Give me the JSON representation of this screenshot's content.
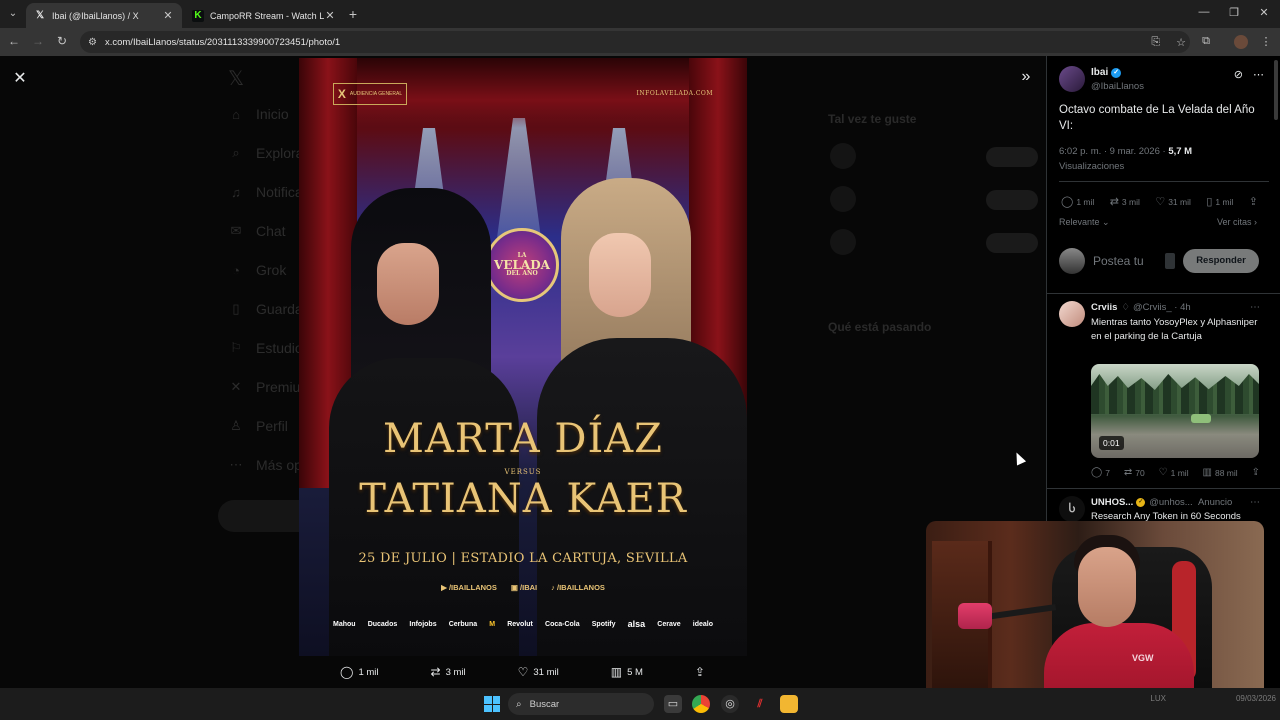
{
  "browser": {
    "tabs": [
      {
        "title": "Ibai (@IbaiLlanos) / X",
        "favicon": "x-logo-icon",
        "active": true
      },
      {
        "title": "CampoRR Stream - Watch Live",
        "favicon": "k-logo-icon",
        "active": false
      }
    ],
    "new_tab": "+",
    "url": "x.com/IbaiLlanos/status/2031113339900723451/photo/1"
  },
  "background_page": {
    "nav": [
      "Inicio",
      "Explorar",
      "Notificaciones",
      "Chat",
      "Grok",
      "Guardados",
      "Estudio",
      "Premium",
      "Perfil",
      "Más opciones"
    ],
    "sidebar_title_1": "Tal vez te guste",
    "sidebar_title_2": "Qué está pasando"
  },
  "poster": {
    "badge": "AUDIENCIA GENERAL",
    "site": "INFOLAVELADA.COM",
    "emblem_top": "LA",
    "emblem_main": "VELADA",
    "emblem_bottom": "DEL AÑO",
    "fighter1": "MARTA DÍAZ",
    "versus": "VERSUS",
    "fighter2": "TATIANA KAER",
    "date_venue": "25 DE JULIO | ESTADIO LA CARTUJA, SEVILLA",
    "socials": [
      "/IBAILLANOS",
      "/IBAI",
      "/IBAILLANOS"
    ],
    "sponsors": [
      "Mahou",
      "Ducados",
      "Infojobs",
      "Cerbuna",
      "M",
      "Revolut",
      "Coca-Cola",
      "Spotify",
      "alsa",
      "Cerave",
      "idealo"
    ]
  },
  "image_actions": {
    "replies": "1 mil",
    "reposts": "3 mil",
    "likes": "31 mil",
    "views": "5 M"
  },
  "post": {
    "author": "Ibai",
    "handle": "@IbaiLlanos",
    "text": "Octavo combate de La Velada del Año VI:",
    "time": "6:02 p. m. · 9 mar. 2026 · ",
    "views_count": "5,7 M",
    "views_label": "Visualizaciones",
    "actions": {
      "replies": "1 mil",
      "reposts": "3 mil",
      "likes": "31 mil",
      "bookmarks": "1 mil"
    },
    "sort": "Relevante",
    "quotes_link": "Ver citas",
    "reply_placeholder": "Postea tu",
    "reply_button": "Responder"
  },
  "reply": {
    "author": "Crviis",
    "handle": "@Crviis_",
    "age": "· 4h",
    "text": "Mientras tanto YosoyPlex y Alphasniper en el parking de la Cartuja",
    "video_duration": "0:01",
    "actions": {
      "replies": "7",
      "reposts": "70",
      "likes": "1 mil",
      "views": "88 mil"
    }
  },
  "ad": {
    "author": "UNHOS...",
    "handle": "@unhos...",
    "label": "Anuncio",
    "text": "Research Any Token in 60 Seconds"
  },
  "webcam": {
    "shirt_logo": "VGW"
  },
  "taskbar": {
    "search_placeholder": "Buscar",
    "date": "09/03/2026",
    "lang": "LUX"
  }
}
